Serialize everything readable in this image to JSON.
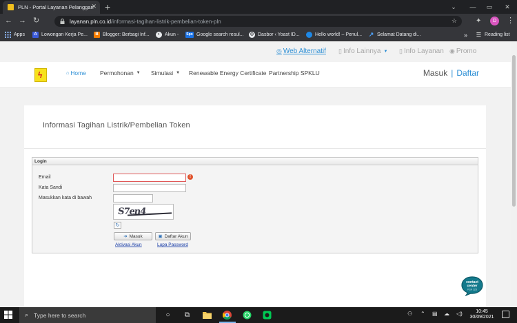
{
  "browser": {
    "tab_title": "PLN - Portal Layanan Pelanggan",
    "url_host": "layanan.pln.co.id",
    "url_path": "/informasi-tagihan-listrik-pembelian-token-pln",
    "profile_initial": "D",
    "bookmarks": [
      {
        "label": "Apps"
      },
      {
        "label": "Lowongan Kerja Pe..."
      },
      {
        "label": "Blogger: Berbagi Inf..."
      },
      {
        "label": "Akun -"
      },
      {
        "label": "Google search resul..."
      },
      {
        "label": "Dasbor ‹ Yoast ID..."
      },
      {
        "label": "Hello world! – Penul..."
      },
      {
        "label": "Selamat Datang di..."
      }
    ],
    "bookmarks_more": "»",
    "reading_list": "Reading list",
    "bookmark_icon_text": "Spo"
  },
  "top_menu": {
    "web_alternatif": "Web Alternatif",
    "info_lainnya": "Info Lainnya",
    "info_layanan": "Info Layanan",
    "promo": "Promo"
  },
  "main_nav": {
    "home": "Home",
    "permohonan": "Permohonan",
    "simulasi": "Simulasi",
    "rec": "Renewable Energy Certificate",
    "spklu": "Partnership SPKLU",
    "masuk": "Masuk",
    "separator": "|",
    "daftar": "Daftar"
  },
  "page": {
    "title": "Informasi Tagihan Listrik/Pembelian Token"
  },
  "login": {
    "heading": "Login",
    "email_label": "Email",
    "email_value": "",
    "password_label": "Kata Sandi",
    "captcha_label": "Masukkan kata di bawah",
    "captcha_value": "",
    "captcha_text": "S7en4",
    "masuk_button": "Masuk",
    "daftar_button": "Daftar Akun",
    "aktivasi_link": "Aktivasi Akun",
    "lupa_link": "Lupa Password"
  },
  "contact_center": {
    "line1": "contact",
    "line2": "center",
    "line3": "PLN 123"
  },
  "taskbar": {
    "search_placeholder": "Type here to search",
    "time": "10:45",
    "date": "30/09/2021"
  },
  "colors": {
    "accent": "#2d8fd5",
    "error": "#e05757",
    "logo_yellow": "#f7e11c"
  }
}
